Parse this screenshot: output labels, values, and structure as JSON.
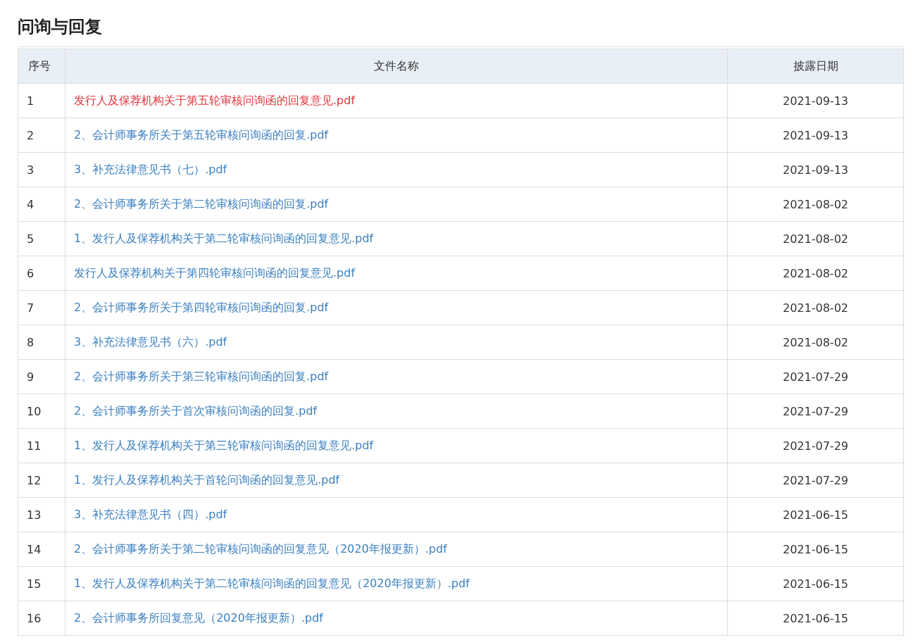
{
  "title": "问询与回复",
  "table": {
    "columns": [
      "序号",
      "文件名称",
      "披露日期"
    ],
    "rows": [
      {
        "index": "1",
        "file": "发行人及保荐机构关于第五轮审核问询函的回复意见.pdf",
        "date": "2021-09-13",
        "selected": true
      },
      {
        "index": "2",
        "file": "2、会计师事务所关于第五轮审核问询函的回复.pdf",
        "date": "2021-09-13",
        "selected": false
      },
      {
        "index": "3",
        "file": "3、补充法律意见书（七）.pdf",
        "date": "2021-09-13",
        "selected": false
      },
      {
        "index": "4",
        "file": "2、会计师事务所关于第二轮审核问询函的回复.pdf",
        "date": "2021-08-02",
        "selected": false
      },
      {
        "index": "5",
        "file": "1、发行人及保荐机构关于第二轮审核问询函的回复意见.pdf",
        "date": "2021-08-02",
        "selected": false
      },
      {
        "index": "6",
        "file": "发行人及保荐机构关于第四轮审核问询函的回复意见.pdf",
        "date": "2021-08-02",
        "selected": false
      },
      {
        "index": "7",
        "file": "2、会计师事务所关于第四轮审核问询函的回复.pdf",
        "date": "2021-08-02",
        "selected": false
      },
      {
        "index": "8",
        "file": "3、补充法律意见书（六）.pdf",
        "date": "2021-08-02",
        "selected": false
      },
      {
        "index": "9",
        "file": "2、会计师事务所关于第三轮审核问询函的回复.pdf",
        "date": "2021-07-29",
        "selected": false
      },
      {
        "index": "10",
        "file": "2、会计师事务所关于首次审核问询函的回复.pdf",
        "date": "2021-07-29",
        "selected": false
      },
      {
        "index": "11",
        "file": "1、发行人及保荐机构关于第三轮审核问询函的回复意见.pdf",
        "date": "2021-07-29",
        "selected": false
      },
      {
        "index": "12",
        "file": "1、发行人及保荐机构关于首轮问询函的回复意见.pdf",
        "date": "2021-07-29",
        "selected": false
      },
      {
        "index": "13",
        "file": "3、补充法律意见书（四）.pdf",
        "date": "2021-06-15",
        "selected": false
      },
      {
        "index": "14",
        "file": "2、会计师事务所关于第二轮审核问询函的回复意见（2020年报更新）.pdf",
        "date": "2021-06-15",
        "selected": false
      },
      {
        "index": "15",
        "file": "1、发行人及保荐机构关于第二轮审核问询函的回复意见（2020年报更新）.pdf",
        "date": "2021-06-15",
        "selected": false
      },
      {
        "index": "16",
        "file": "2、会计师事务所回复意见（2020年报更新）.pdf",
        "date": "2021-06-15",
        "selected": false
      }
    ]
  }
}
